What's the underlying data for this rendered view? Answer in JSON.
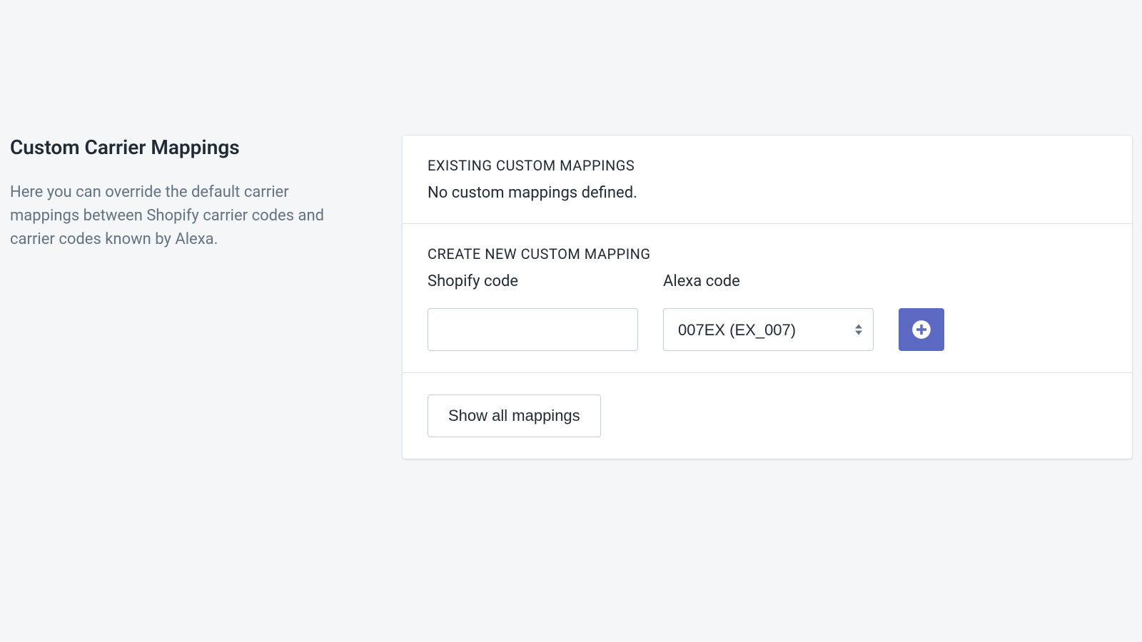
{
  "sidebar": {
    "title": "Custom Carrier Mappings",
    "description": "Here you can override the default carrier mappings between Shopify carrier codes and carrier codes known by Alexa."
  },
  "existing": {
    "heading": "EXISTING CUSTOM MAPPINGS",
    "empty_text": "No custom mappings defined."
  },
  "create": {
    "heading": "CREATE NEW CUSTOM MAPPING",
    "shopify_label": "Shopify code",
    "alexa_label": "Alexa code",
    "shopify_value": "",
    "alexa_selected": "007EX (EX_007)"
  },
  "actions": {
    "show_all_label": "Show all mappings"
  }
}
